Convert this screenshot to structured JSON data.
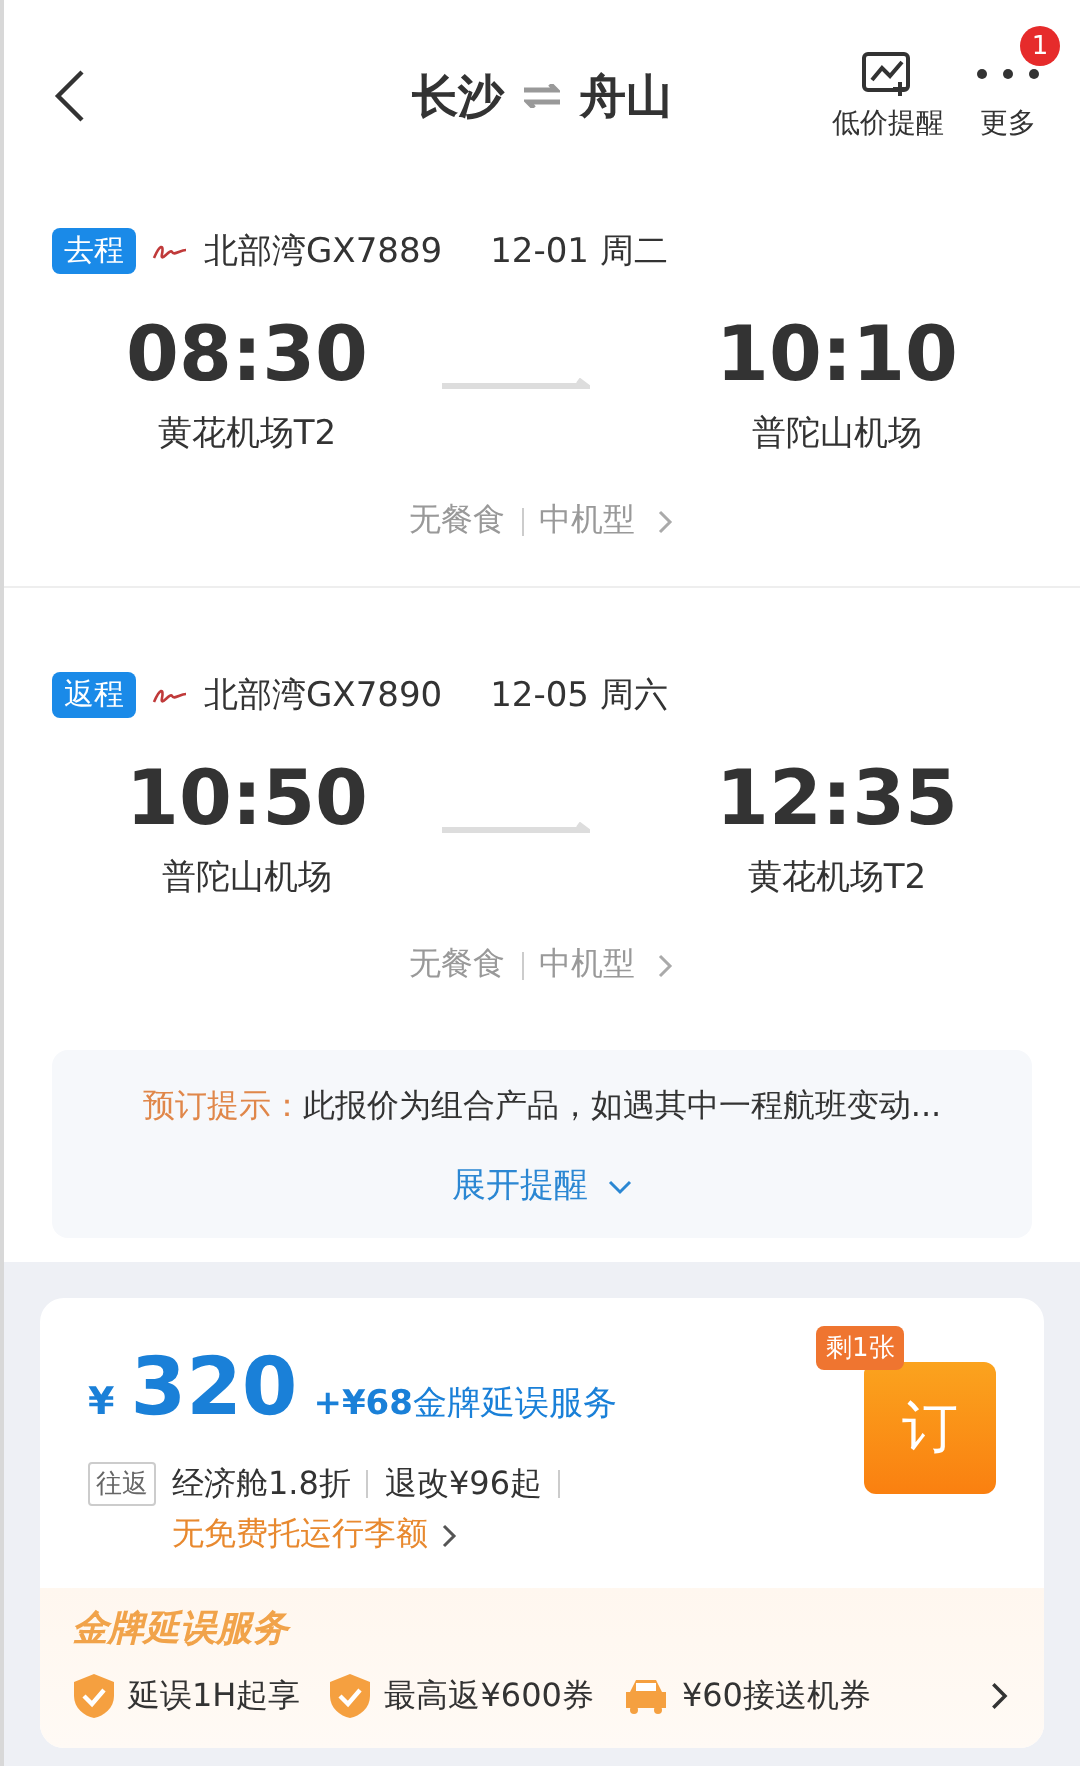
{
  "header": {
    "origin": "长沙",
    "destination": "舟山",
    "actions": [
      {
        "kind": "alert",
        "label": "低价提醒"
      },
      {
        "kind": "more",
        "label": "更多",
        "badge": "1"
      }
    ]
  },
  "segments": [
    {
      "tag": "去程",
      "airline": "北部湾GX7889",
      "date": "12-01 周二",
      "depart_time": "08:30",
      "depart_airport": "黄花机场T2",
      "arrive_time": "10:10",
      "arrive_airport": "普陀山机场",
      "meal": "无餐食",
      "aircraft": "中机型"
    },
    {
      "tag": "返程",
      "airline": "北部湾GX7890",
      "date": "12-05 周六",
      "depart_time": "10:50",
      "depart_airport": "普陀山机场",
      "arrive_time": "12:35",
      "arrive_airport": "黄花机场T2",
      "meal": "无餐食",
      "aircraft": "中机型"
    }
  ],
  "notice": {
    "label": "预订提示：",
    "text": "此报价为组合产品，如遇其中一程航班变动...",
    "expand": "展开提醒"
  },
  "offer": {
    "currency": "¥",
    "price": "320",
    "addon": "+¥68",
    "addon_label": "金牌延误服务",
    "trip_tag": "往返",
    "cabin": "经济舱1.8折",
    "refund": "退改¥96起",
    "baggage": "无免费托运行李额",
    "remaining": "剩1张",
    "book": "订",
    "service_title": "金牌延误服务",
    "benefits": [
      {
        "kind": "shield",
        "text": "延误1H起享"
      },
      {
        "kind": "shield",
        "text": "最高返¥600券"
      },
      {
        "kind": "car",
        "text": "¥60接送机券"
      }
    ]
  }
}
